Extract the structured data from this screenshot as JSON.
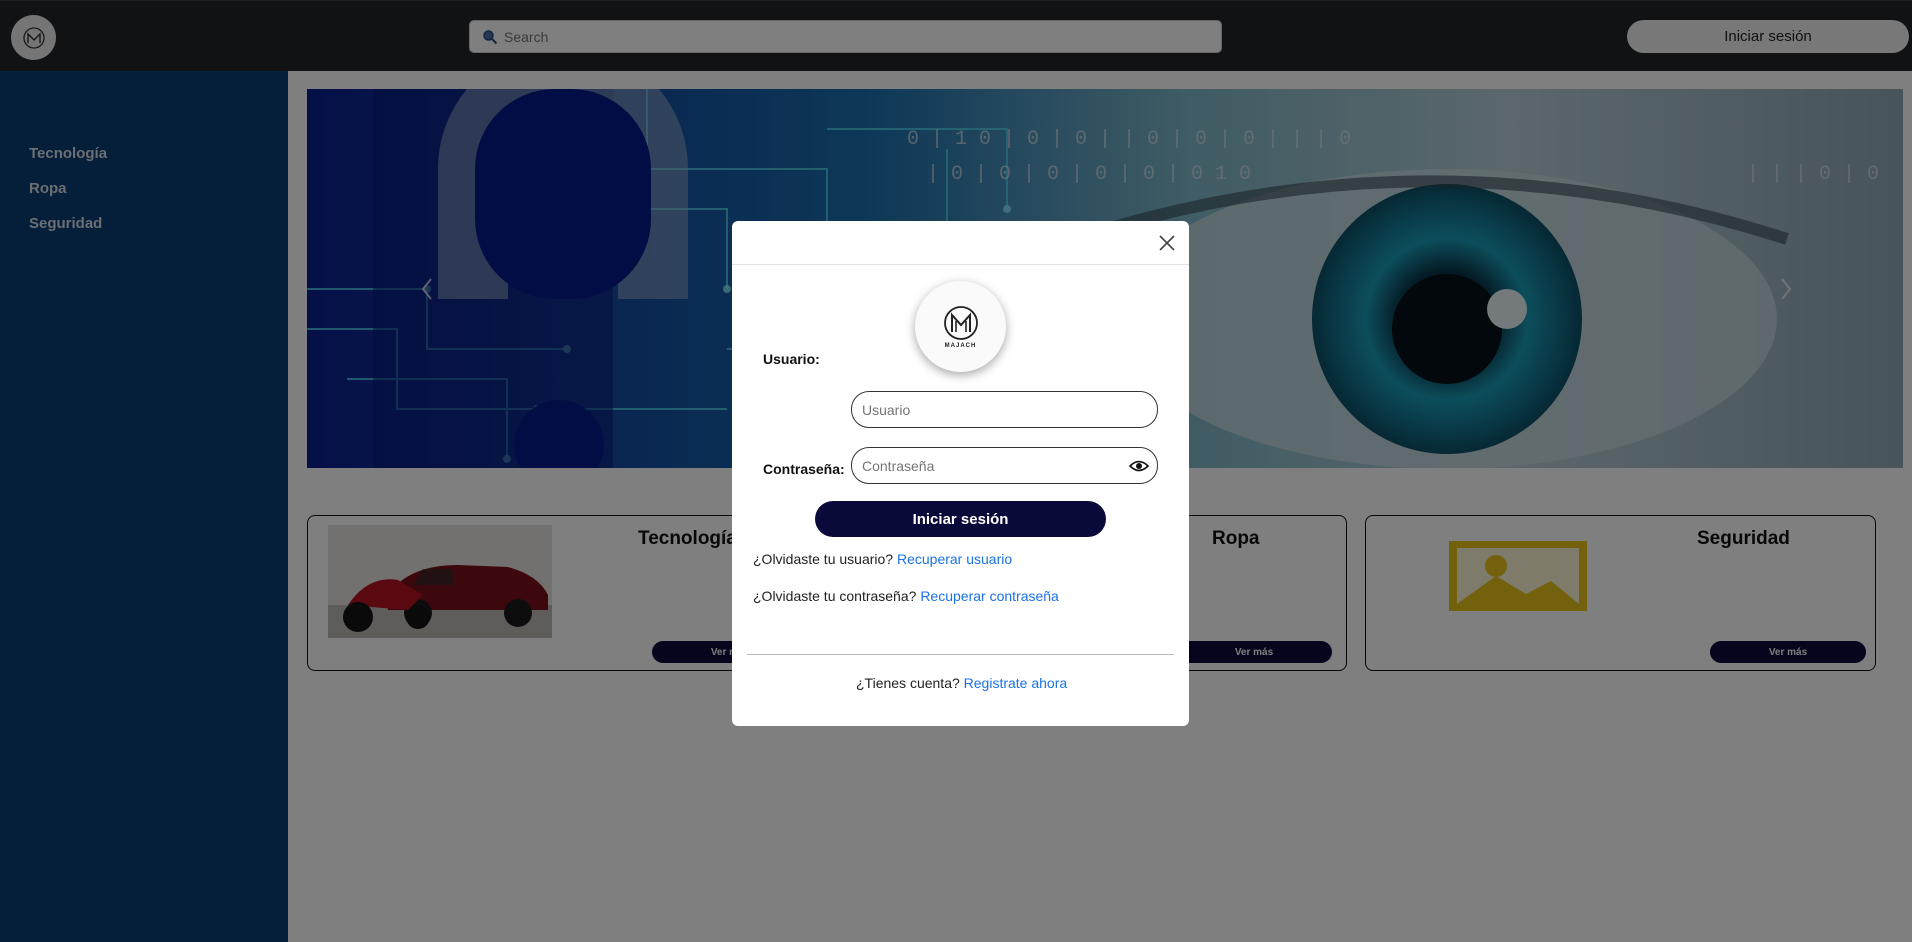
{
  "header": {
    "logo_label": "MAJACH",
    "search_placeholder": "Search",
    "login_label": "Iniciar sesión"
  },
  "sidebar": {
    "items": [
      {
        "label": "Tecnología"
      },
      {
        "label": "Ropa"
      },
      {
        "label": "Seguridad"
      }
    ]
  },
  "cards": [
    {
      "title": "Tecnología",
      "button": "Ver más"
    },
    {
      "title": "Ropa",
      "button": "Ver más"
    },
    {
      "title": "Seguridad",
      "button": "Ver más"
    }
  ],
  "modal": {
    "brand": "MAJACH",
    "user_label": "Usuario:",
    "user_placeholder": "Usuario",
    "password_label": "Contraseña:",
    "password_placeholder": "Contraseña",
    "submit_label": "Iniciar sesión",
    "forgot_user_text": "¿Olvidaste tu usuario?",
    "forgot_user_link": "Recuperar usuario",
    "forgot_pass_text": "¿Olvidaste tu contraseña?",
    "forgot_pass_link": "Recuperar contraseña",
    "account_text": "¿Tienes cuenta?",
    "register_link": "Registrate ahora"
  },
  "colors": {
    "topbar": "#212529",
    "sidebar": "#0b3d73",
    "primary_button": "#0a0a3a",
    "link": "#1a73e8"
  }
}
